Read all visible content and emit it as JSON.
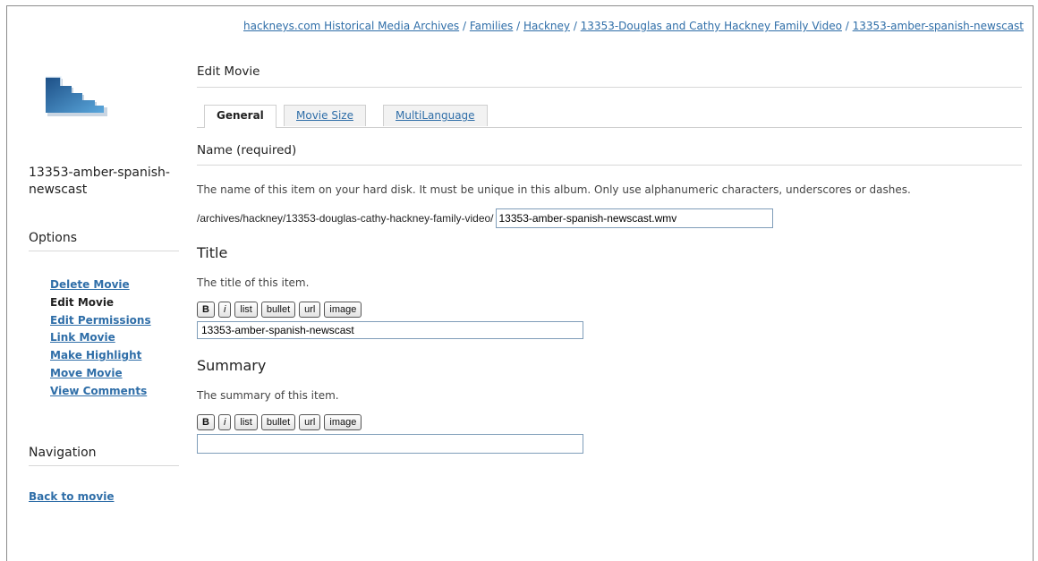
{
  "breadcrumb": [
    {
      "label": "hackneys.com Historical Media Archives"
    },
    {
      "label": "Families"
    },
    {
      "label": "Hackney"
    },
    {
      "label": "13353-Douglas and Cathy Hackney Family Video"
    },
    {
      "label": "13353-amber-spanish-newscast"
    }
  ],
  "breadcrumb_separator": " / ",
  "sidebar": {
    "item_title": "13353-amber-spanish-newscast",
    "options_heading": "Options",
    "options": [
      {
        "label": "Delete Movie",
        "current": false
      },
      {
        "label": "Edit Movie",
        "current": true
      },
      {
        "label": "Edit Permissions",
        "current": false
      },
      {
        "label": "Link Movie",
        "current": false
      },
      {
        "label": "Make Highlight",
        "current": false
      },
      {
        "label": "Move Movie",
        "current": false
      },
      {
        "label": "View Comments",
        "current": false
      }
    ],
    "navigation_heading": "Navigation",
    "back_link": "Back to movie"
  },
  "main": {
    "page_title": "Edit Movie",
    "tabs": [
      {
        "label": "General",
        "active": true
      },
      {
        "label": "Movie Size",
        "active": false
      },
      {
        "label": "MultiLanguage",
        "active": false
      }
    ],
    "name_section": {
      "heading": "Name (required)",
      "description": "The name of this item on your hard disk. It must be unique in this album. Only use alphanumeric characters, underscores or dashes.",
      "path_prefix": "/archives/hackney/13353-douglas-cathy-hackney-family-video/",
      "value": "13353-amber-spanish-newscast.wmv"
    },
    "title_section": {
      "heading": "Title",
      "description": "The title of this item.",
      "value": "13353-amber-spanish-newscast"
    },
    "summary_section": {
      "heading": "Summary",
      "description": "The summary of this item.",
      "value": ""
    },
    "toolbar": {
      "bold": "B",
      "italic": "i",
      "list": "list",
      "bullet": "bullet",
      "url": "url",
      "image": "image"
    }
  },
  "colors": {
    "link": "#2f6ea8",
    "border": "#8c8c8c",
    "input_border": "#7f9db9"
  }
}
